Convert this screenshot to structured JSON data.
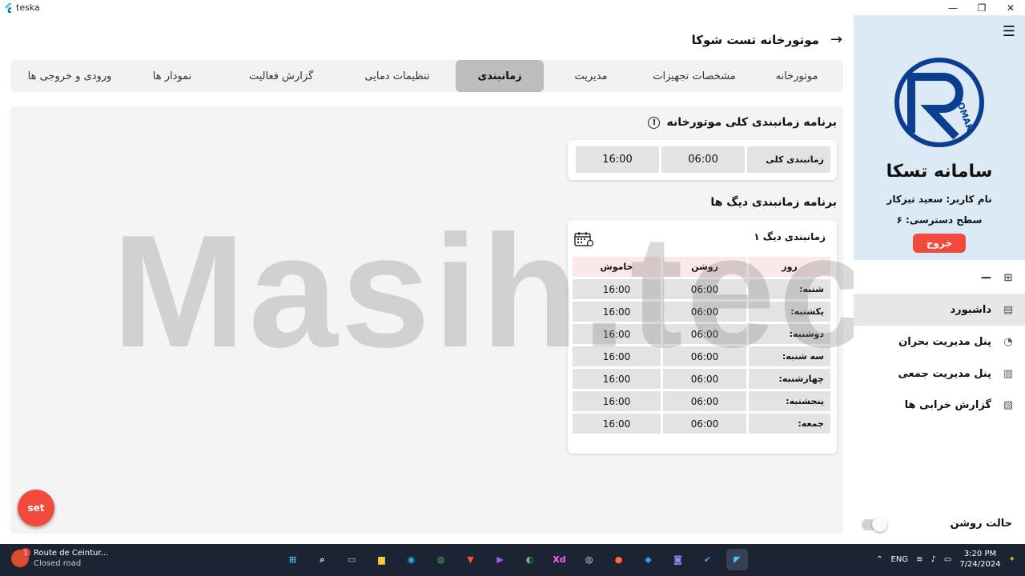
{
  "window": {
    "title": "teska",
    "controls": [
      "—",
      "❐",
      "✕"
    ]
  },
  "header": {
    "title": "موتورخانه تست شوکا",
    "back_icon": "arrow-right-icon"
  },
  "tabs": [
    {
      "label": "موتورخانه",
      "active": false
    },
    {
      "label": "مشخصات تجهیزات",
      "active": false
    },
    {
      "label": "مدیریت",
      "active": false
    },
    {
      "label": "زمانبندی",
      "active": true
    },
    {
      "label": "تنظیمات دمایی",
      "active": false
    },
    {
      "label": "گزارش فعالیت",
      "active": false
    },
    {
      "label": "نمودار ها",
      "active": false
    },
    {
      "label": "ورودی و خروجی ها",
      "active": false
    }
  ],
  "general_schedule": {
    "title": "برنامه زمانبندی کلی موتورخانه",
    "info_icon": "!",
    "label": "زمانبندی کلی",
    "on": "06:00",
    "off": "16:00"
  },
  "boilers": {
    "title": "برنامه زمانبندی دیگ ها",
    "boiler1": {
      "name": "زمانبندی دیگ ۱",
      "headers": {
        "day": "روز",
        "on": "روشن",
        "off": "خاموش"
      },
      "rows": [
        {
          "day": "شنبه:",
          "on": "06:00",
          "off": "16:00"
        },
        {
          "day": "یکشنبه:",
          "on": "06:00",
          "off": "16:00"
        },
        {
          "day": "دوشنبه:",
          "on": "06:00",
          "off": "16:00"
        },
        {
          "day": "سه شنبه:",
          "on": "06:00",
          "off": "16:00"
        },
        {
          "day": "چهارشنبه:",
          "on": "06:00",
          "off": "16:00"
        },
        {
          "day": "پنجشنبه:",
          "on": "06:00",
          "off": "16:00"
        },
        {
          "day": "جمعه:",
          "on": "06:00",
          "off": "16:00"
        }
      ]
    }
  },
  "fab": {
    "label": "set"
  },
  "watermark": "Masih.tech",
  "sidebar": {
    "logo_text": "ROMAK",
    "brand": "سامانه تسکا",
    "user": "نام کاربر: سعید تیزکار",
    "level": "سطح دسترسی: ۶",
    "logout": "خروج",
    "dash_line": "—",
    "nav": [
      {
        "label": "داشبورد",
        "icon": "document-icon",
        "glyph": "▤",
        "active": true
      },
      {
        "label": "پنل مدیریت بحران",
        "icon": "pie-chart-icon",
        "glyph": "◔",
        "active": false
      },
      {
        "label": "پنل مدیریت جمعی",
        "icon": "bar-chart-icon",
        "glyph": "▥",
        "active": false
      },
      {
        "label": "گزارش خرابی ها",
        "icon": "report-icon",
        "glyph": "▧",
        "active": false
      }
    ],
    "theme_label": "حالت روشن"
  },
  "taskbar": {
    "notif_title": "Route de Ceintur...",
    "notif_sub": "Closed road",
    "notif_badge": "1",
    "lang": "ENG",
    "time": "3:20 PM",
    "date": "7/24/2024",
    "accent": "#f14a3c"
  }
}
